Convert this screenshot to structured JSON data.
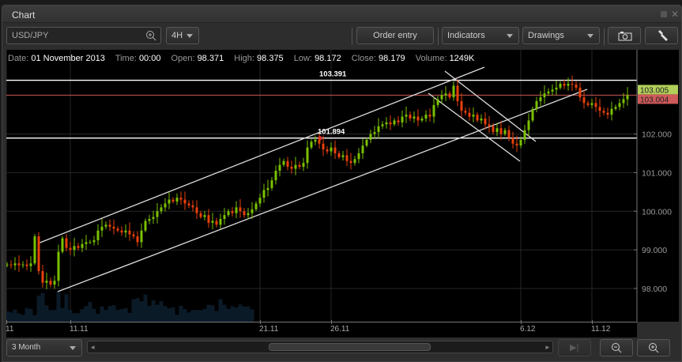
{
  "window": {
    "title": "Chart"
  },
  "toolbar": {
    "symbol": "USD/JPY",
    "interval": "4H",
    "order_entry": "Order entry",
    "indicators": "Indicators",
    "drawings": "Drawings"
  },
  "info": {
    "date_label": "Date:",
    "date": "01 November 2013",
    "time_label": "Time:",
    "time": "00:00",
    "open_label": "Open:",
    "open": "98.371",
    "high_label": "High:",
    "high": "98.375",
    "low_label": "Low:",
    "low": "98.172",
    "close_label": "Close:",
    "close": "98.179",
    "volume_label": "Volume:",
    "volume": "1249K"
  },
  "bottom": {
    "range": "3 Month",
    "scroll_position": 0.6
  },
  "colors": {
    "up": "#7ac100",
    "down": "#e8400c",
    "bid_bg": "#b2cf5a",
    "ask_bg": "#cf5a5a",
    "volume": "#0b1a27"
  },
  "chart_data": {
    "type": "candlestick",
    "symbol": "USD/JPY",
    "y_ticks": [
      "98.000",
      "99.000",
      "100.000",
      "101.000",
      "102.000"
    ],
    "y_tick_values": [
      98,
      99,
      100,
      101,
      102
    ],
    "x_ticks": [
      "11",
      "11.11",
      "21.11",
      "26.11",
      "6.12",
      "11.12"
    ],
    "x_tick_index": [
      -0.2,
      16,
      64,
      82,
      130,
      148
    ],
    "ylim": [
      97.14,
      104.18
    ],
    "bid": "103.005",
    "ask": "103.004",
    "levels": [
      {
        "label": "103.391",
        "value": 103.391
      },
      {
        "label": "101.894",
        "value": 101.894
      }
    ],
    "current_price": 103.005,
    "close": [
      98.62,
      98.6,
      98.65,
      98.6,
      98.62,
      98.58,
      98.65,
      99.35,
      98.45,
      98.15,
      98.2,
      98.1,
      98.2,
      98.95,
      99.3,
      99.05,
      99.0,
      99.1,
      99.05,
      99.15,
      99.2,
      99.2,
      99.25,
      99.5,
      99.6,
      99.65,
      99.6,
      99.55,
      99.5,
      99.45,
      99.5,
      99.4,
      99.35,
      99.2,
      99.5,
      99.75,
      99.8,
      99.85,
      100.0,
      100.1,
      100.2,
      100.3,
      100.25,
      100.35,
      100.3,
      100.2,
      100.15,
      100.1,
      99.95,
      99.85,
      99.9,
      99.7,
      99.75,
      99.65,
      99.8,
      99.9,
      100.0,
      99.95,
      100.1,
      100.0,
      99.9,
      99.95,
      100.05,
      100.2,
      100.35,
      100.55,
      100.6,
      100.8,
      101.05,
      101.2,
      101.3,
      101.15,
      101.1,
      101.2,
      101.15,
      101.25,
      101.65,
      101.8,
      101.85,
      101.75,
      101.6,
      101.55,
      101.65,
      101.5,
      101.4,
      101.45,
      101.3,
      101.25,
      101.35,
      101.5,
      101.7,
      101.85,
      102.0,
      102.05,
      102.2,
      102.25,
      102.3,
      102.25,
      102.35,
      102.3,
      102.45,
      102.5,
      102.4,
      102.45,
      102.35,
      102.4,
      102.5,
      102.45,
      102.75,
      102.9,
      103.0,
      103.05,
      102.95,
      103.25,
      102.85,
      102.6,
      102.55,
      102.45,
      102.5,
      102.35,
      102.4,
      102.25,
      102.2,
      102.05,
      102.15,
      102.0,
      102.1,
      101.9,
      101.75,
      101.7,
      101.85,
      102.1,
      102.35,
      102.65,
      102.85,
      102.95,
      103.05,
      103.1,
      103.15,
      103.2,
      103.3,
      103.25,
      103.3,
      103.28,
      103.2,
      102.95,
      102.8,
      102.75,
      102.8,
      102.7,
      102.6,
      102.55,
      102.5,
      102.65,
      102.7,
      102.8,
      102.9,
      103.005
    ],
    "volume": [
      380,
      340,
      450,
      300,
      250,
      500,
      470,
      240,
      950,
      1050,
      600,
      420,
      430,
      1080,
      500,
      1000,
      430,
      310,
      310,
      460,
      570,
      730,
      470,
      290,
      560,
      430,
      570,
      600,
      430,
      460,
      500,
      320,
      820,
      870,
      750,
      990,
      580,
      780,
      620,
      750,
      570,
      490,
      530,
      250,
      580,
      460,
      340,
      430,
      430,
      420,
      470,
      620,
      600,
      390,
      820,
      620,
      470,
      570,
      520,
      630,
      550,
      560,
      450
    ],
    "volume_max": 1300
  }
}
